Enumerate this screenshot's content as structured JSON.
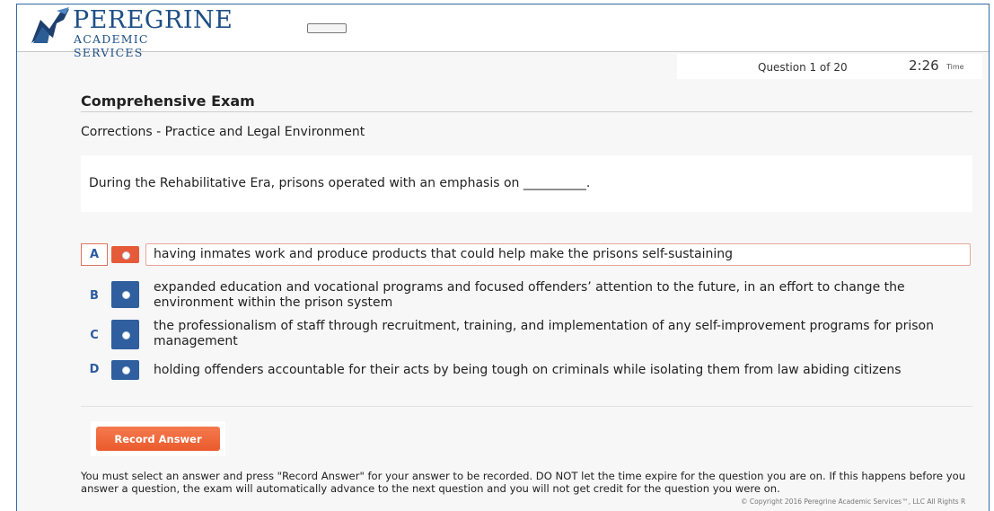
{
  "header": {
    "logo_line1": "PEREGRINE",
    "logo_line2": "ACADEMIC SERVICES"
  },
  "status": {
    "question_counter": "Question 1 of 20",
    "timer_value": "2:26",
    "timer_label": "Time"
  },
  "exam": {
    "title": "Comprehensive Exam",
    "subject": "Corrections - Practice and Legal Environment",
    "question": "During the Rehabilitative Era, prisons operated with an emphasis on __________."
  },
  "answers": [
    {
      "letter": "A",
      "text": "having inmates work and produce products that could help make the prisons self-sustaining",
      "selected": true
    },
    {
      "letter": "B",
      "text": "expanded education and vocational programs and focused offenders’ attention to the future, in an effort to change the environment within the prison system",
      "selected": false
    },
    {
      "letter": "C",
      "text": "the professionalism of staff through recruitment, training, and implementation of any self-improvement programs for prison management",
      "selected": false
    },
    {
      "letter": "D",
      "text": "holding offenders accountable for their acts by being tough on criminals while isolating them from law abiding citizens",
      "selected": false
    }
  ],
  "actions": {
    "record_label": "Record Answer"
  },
  "footer": {
    "instructions": "You must select an answer and press \"Record Answer\" for your answer to be recorded. DO NOT let the time expire for the question you are on. If this happens before you answer a question, the exam will automatically advance to the next question and you will not get credit for the question you were on.",
    "copyright": "© Copyright 2016 Peregrine Academic Services™, LLC All Rights R"
  },
  "colors": {
    "brand_blue": "#1e4f86",
    "radio_blue": "#2f5f9e",
    "accent_orange": "#ea5a2c",
    "frame_border": "#2f6aa6"
  }
}
